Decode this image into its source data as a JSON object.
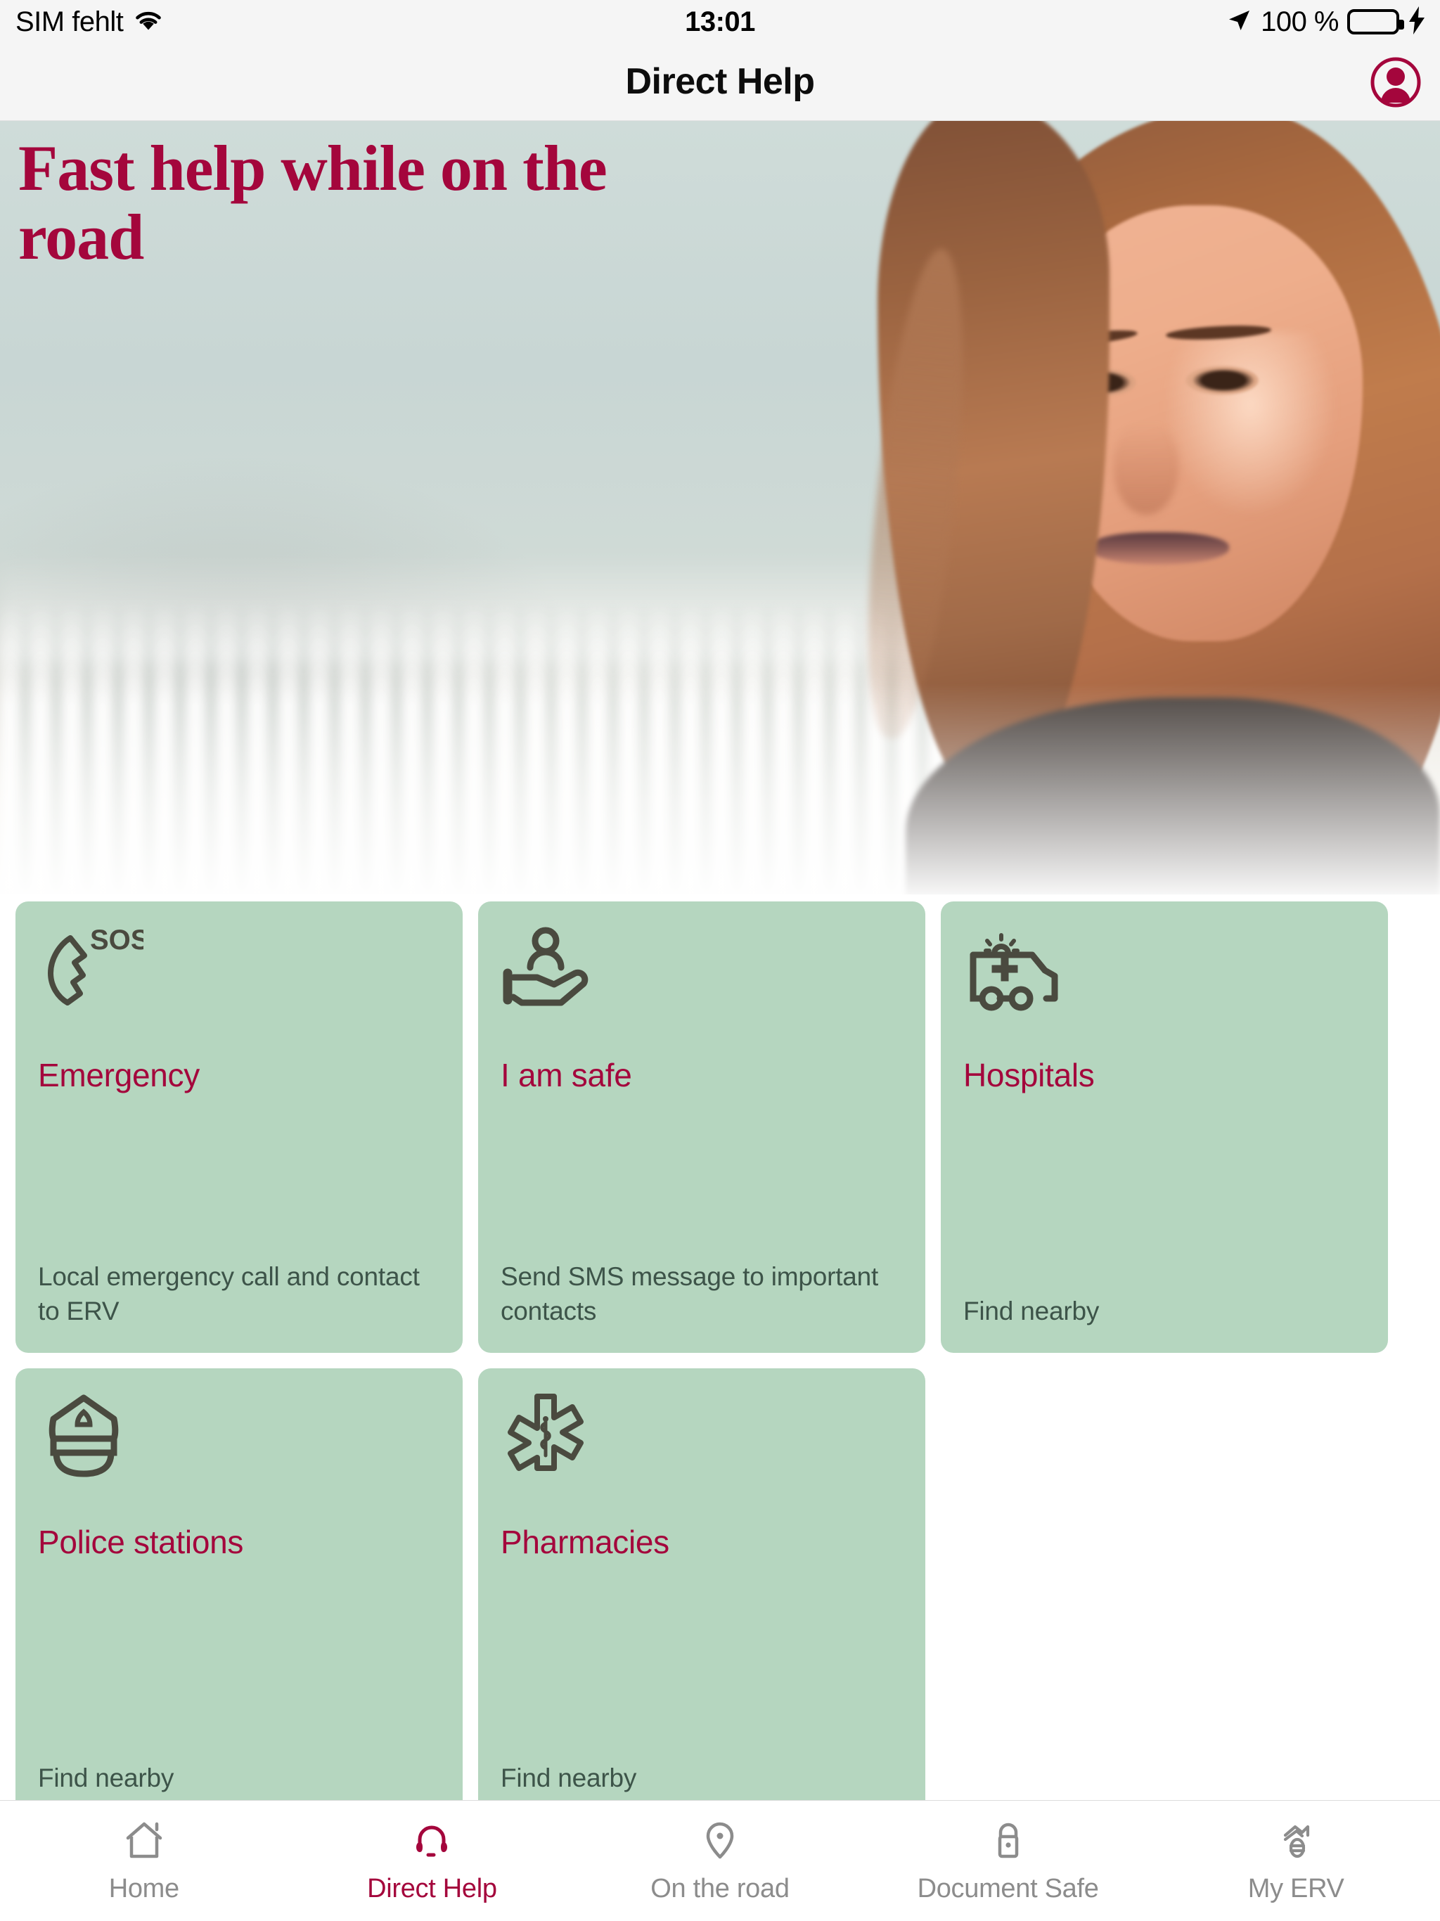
{
  "status_bar": {
    "carrier": "SIM fehlt",
    "wifi_icon": "wifi-icon",
    "time": "13:01",
    "location_icon": "location-arrow-icon",
    "battery_percent": "100 %",
    "battery_icon": "battery-full-icon",
    "charging_icon": "lightning-bolt-icon"
  },
  "nav": {
    "title": "Direct Help",
    "avatar_icon": "user-avatar-icon"
  },
  "hero": {
    "headline": "Fast help while on the road"
  },
  "colors": {
    "brand_crimson": "#a4063c",
    "card_green": "#b5d6bf",
    "card_icon": "#4a4a3f",
    "card_desc": "#3d5449",
    "tab_inactive": "#8c8c8c",
    "battery_green": "#4cd662"
  },
  "cards": [
    {
      "icon": "phone-sos-icon",
      "title": "Emergency",
      "description": "Local emergency call and contact to ERV"
    },
    {
      "icon": "person-in-hand-icon",
      "title": "I am safe",
      "description": "Send SMS message to important contacts"
    },
    {
      "icon": "ambulance-icon",
      "title": "Hospitals",
      "description": "Find nearby"
    },
    {
      "icon": "police-cap-icon",
      "title": "Police stations",
      "description": "Find nearby"
    },
    {
      "icon": "star-of-life-icon",
      "title": "Pharmacies",
      "description": "Find nearby"
    }
  ],
  "tabs": [
    {
      "icon": "home-icon",
      "label": "Home",
      "active": false
    },
    {
      "icon": "headset-icon",
      "label": "Direct Help",
      "active": true
    },
    {
      "icon": "map-pin-icon",
      "label": "On the road",
      "active": false
    },
    {
      "icon": "padlock-icon",
      "label": "Document Safe",
      "active": false
    },
    {
      "icon": "erv-logo-icon",
      "label": "My ERV",
      "active": false
    }
  ]
}
